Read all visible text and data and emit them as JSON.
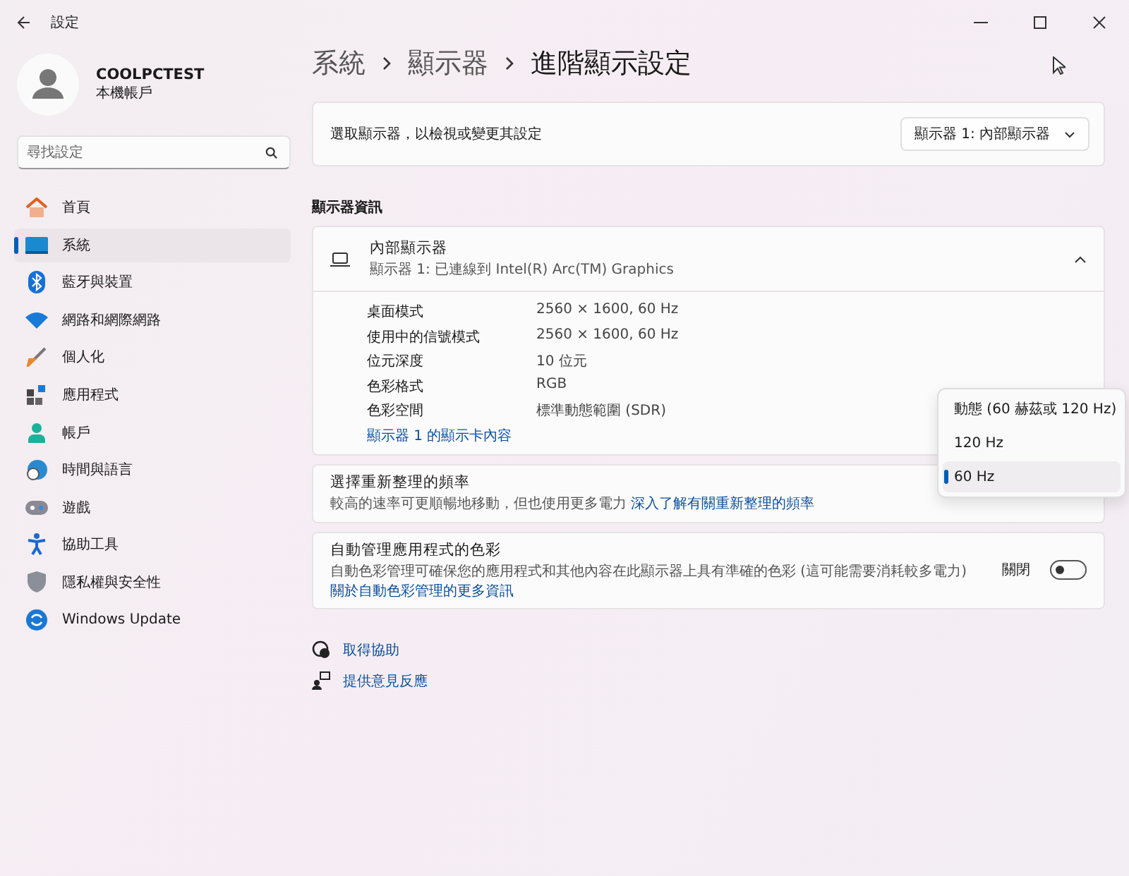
{
  "window": {
    "title": "設定"
  },
  "account": {
    "name": "COOLPCTEST",
    "type": "本機帳戶"
  },
  "search": {
    "placeholder": "尋找設定"
  },
  "nav": [
    {
      "label": "首頁",
      "selected": false
    },
    {
      "label": "系統",
      "selected": true
    },
    {
      "label": "藍牙與裝置",
      "selected": false
    },
    {
      "label": "網路和網際網路",
      "selected": false
    },
    {
      "label": "個人化",
      "selected": false
    },
    {
      "label": "應用程式",
      "selected": false
    },
    {
      "label": "帳戶",
      "selected": false
    },
    {
      "label": "時間與語言",
      "selected": false
    },
    {
      "label": "遊戲",
      "selected": false
    },
    {
      "label": "協助工具",
      "selected": false
    },
    {
      "label": "隱私權與安全性",
      "selected": false
    },
    {
      "label": "Windows Update",
      "selected": false
    }
  ],
  "breadcrumb": [
    "系統",
    "顯示器",
    "進階顯示設定"
  ],
  "display_select": {
    "label": "選取顯示器，以檢視或變更其設定",
    "value": "顯示器 1: 內部顯示器"
  },
  "section_title": "顯示器資訊",
  "display_card": {
    "title": "內部顯示器",
    "subtitle": "顯示器 1: 已連線到 Intel(R) Arc(TM) Graphics",
    "expanded": true,
    "info": [
      {
        "label": "桌面模式",
        "value": "2560 × 1600, 60 Hz"
      },
      {
        "label": "使用中的信號模式",
        "value": "2560 × 1600, 60 Hz"
      },
      {
        "label": "位元深度",
        "value": "10 位元"
      },
      {
        "label": "色彩格式",
        "value": "RGB"
      },
      {
        "label": "色彩空間",
        "value": "標準動態範圍 (SDR)"
      }
    ],
    "link": "顯示器 1 的顯示卡內容"
  },
  "refresh_rate": {
    "title": "選擇重新整理的頻率",
    "description": "較高的速率可更順暢地移動，但也使用更多電力",
    "link": "深入了解有關重新整理的頻率",
    "options": [
      {
        "label": "動態 (60 赫茲或 120 Hz)",
        "selected": false
      },
      {
        "label": "120 Hz",
        "selected": false
      },
      {
        "label": "60 Hz",
        "selected": true
      }
    ]
  },
  "color_management": {
    "title": "自動管理應用程式的色彩",
    "description": "自動色彩管理可確保您的應用程式和其他內容在此顯示器上具有準確的色彩 (這可能需要消耗較多電力)",
    "link": "關於自動色彩管理的更多資訊",
    "toggle_label": "關閉",
    "on": false
  },
  "help_links": [
    "取得協助",
    "提供意見反應"
  ]
}
